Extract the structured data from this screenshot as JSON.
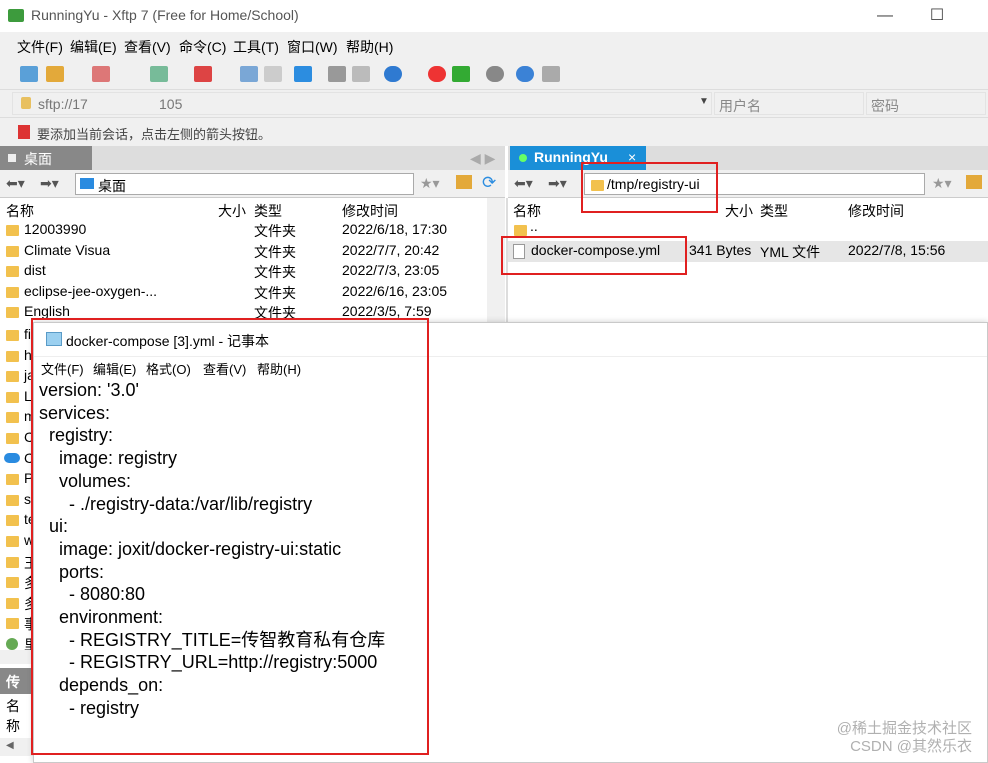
{
  "window_title": "RunningYu - Xftp 7 (Free for Home/School)",
  "window_controls": {
    "minimize": "—",
    "maximize": "☐",
    "close": "✕"
  },
  "menu": [
    "文件(F)",
    "编辑(E)",
    "查看(V)",
    "命令(C)",
    "工具(T)",
    "窗口(W)",
    "帮助(H)"
  ],
  "address": {
    "host": "sftp://17",
    "host_suffix": "105",
    "user_placeholder": "用户名",
    "password_placeholder": "密码"
  },
  "hint": "要添加当前会话，点击左侧的箭头按钮。",
  "left": {
    "tab": "桌面",
    "path": "桌面",
    "columns": {
      "name": "名称",
      "size": "大小",
      "type": "类型",
      "modified": "修改时间"
    },
    "rows": [
      {
        "name": "12003990",
        "type": "文件夹",
        "modified": "2022/6/18, 17:30"
      },
      {
        "name": "Climate Visua",
        "type": "文件夹",
        "modified": "2022/7/7, 20:42"
      },
      {
        "name": "dist",
        "type": "文件夹",
        "modified": "2022/7/3, 23:05"
      },
      {
        "name": "eclipse-jee-oxygen-...",
        "type": "文件夹",
        "modified": "2022/6/16, 23:05"
      },
      {
        "name": "English",
        "type": "文件夹",
        "modified": "2022/3/5, 7:59"
      }
    ],
    "hidden_row_initials": [
      "fi",
      "h",
      "ja",
      "L",
      "m",
      "C",
      "C",
      "P",
      "s",
      "te",
      "w",
      "王",
      "多",
      "多",
      "事",
      "里"
    ],
    "bottom_tab": "传输",
    "bottom_header": "名称"
  },
  "right": {
    "tab": "RunningYu",
    "path": "/tmp/registry-ui",
    "columns": {
      "name": "名称",
      "size": "大小",
      "type": "类型",
      "modified": "修改时间"
    },
    "rows": [
      {
        "name": "..",
        "size": "",
        "type": "",
        "modified": ""
      },
      {
        "name": "docker-compose.yml",
        "size": "341 Bytes",
        "type": "YML 文件",
        "modified": "2022/7/8, 15:56"
      }
    ]
  },
  "notepad": {
    "title": "docker-compose [3].yml - 记事本",
    "menu": [
      "文件(F)",
      "编辑(E)",
      "格式(O)",
      "查看(V)",
      "帮助(H)"
    ],
    "content": "version: '3.0'\nservices:\n  registry:\n    image: registry\n    volumes:\n      - ./registry-data:/var/lib/registry\n  ui:\n    image: joxit/docker-registry-ui:static\n    ports:\n      - 8080:80\n    environment:\n      - REGISTRY_TITLE=传智教育私有仓库\n      - REGISTRY_URL=http://registry:5000\n    depends_on:\n      - registry"
  },
  "watermark": {
    "line1": "@稀土掘金技术社区",
    "line2": "CSDN @其然乐衣"
  },
  "colors": {
    "highlight_red": "#e02020",
    "folder": "#f2c14e",
    "active_tab": "#1a8fd8",
    "selected_row": "#e6e6e6"
  }
}
